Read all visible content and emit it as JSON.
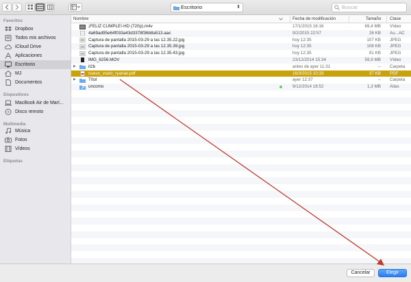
{
  "toolbar": {
    "location": "Escritorio",
    "search_placeholder": "Buscar"
  },
  "sidebar": {
    "sections": [
      {
        "title": "Favoritos",
        "items": [
          {
            "label": "Dropbox",
            "icon": "dropbox-icon"
          },
          {
            "label": "Todos mis archivos",
            "icon": "all-files-icon"
          },
          {
            "label": "iCloud Drive",
            "icon": "cloud-icon"
          },
          {
            "label": "Aplicaciones",
            "icon": "applications-icon"
          },
          {
            "label": "Escritorio",
            "icon": "desktop-icon",
            "selected": true
          },
          {
            "label": "MJ",
            "icon": "home-icon"
          },
          {
            "label": "Documentos",
            "icon": "documents-icon"
          }
        ]
      },
      {
        "title": "Dispositivos",
        "items": [
          {
            "label": "MacBook Air de Marí...",
            "icon": "laptop-icon"
          },
          {
            "label": "Disco remoto",
            "icon": "disc-icon"
          }
        ]
      },
      {
        "title": "Multimedia",
        "items": [
          {
            "label": "Música",
            "icon": "music-icon"
          },
          {
            "label": "Fotos",
            "icon": "camera-icon"
          },
          {
            "label": "Vídeos",
            "icon": "film-icon"
          }
        ]
      },
      {
        "title": "Etiquetas",
        "items": []
      }
    ]
  },
  "columns": {
    "name": "Nombre",
    "date": "Fecha de modificación",
    "size": "Tamaño",
    "kind": "Clase"
  },
  "files": [
    {
      "name": "¡FELIZ CUMPLE!-HD (720p).m4v",
      "date": "17/1/2015 16:16",
      "size": "69,4 MB",
      "kind": "Vídeo",
      "icon": "video-file-icon"
    },
    {
      "name": "4a69ad95e64f033a43d3378f36b8a513.aac",
      "date": "9/2/2015 22:57",
      "size": "26 KB",
      "kind": "Au...AC",
      "icon": "audio-file-icon"
    },
    {
      "name": "Captura de pantalla 2015-03-29 a las 12.35.22.jpg",
      "date": "hoy 12:35",
      "size": "107 KB",
      "kind": "JPEG",
      "icon": "image-file-icon"
    },
    {
      "name": "Captura de pantalla 2015-03-29 a las 12.35.39.jpg",
      "date": "hoy 12:35",
      "size": "108 KB",
      "kind": "JPEG",
      "icon": "image-file-icon"
    },
    {
      "name": "Captura de pantalla 2015-03-29 a las 12.35.43.jpg",
      "date": "hoy 12:35",
      "size": "91 KB",
      "kind": "JPEG",
      "icon": "image-file-icon"
    },
    {
      "name": "IMG_6256.MOV",
      "date": "23/12/2014 15:34",
      "size": "59,9 MB",
      "kind": "Vídeo",
      "icon": "movie-file-icon"
    },
    {
      "name": "it2b",
      "date": "antes de ayer 11:31",
      "size": "--",
      "kind": "Carpeta",
      "icon": "folder-icon",
      "folder": true
    },
    {
      "name": "nuevo_vuelo_ryanair.pdf",
      "date": "16/3/2015 10:33",
      "size": "37 KB",
      "kind": "PDF",
      "icon": "pdf-file-icon",
      "selected": true
    },
    {
      "name": "Títol",
      "date": "ayer 12:37",
      "size": "--",
      "kind": "Carpeta",
      "icon": "folder-icon",
      "folder": true
    },
    {
      "name": "uncomo",
      "date": "9/12/2014 18:52",
      "size": "1,3 MB",
      "kind": "Alias",
      "icon": "alias-icon",
      "tag": true
    }
  ],
  "colors": {
    "selection": "#c8a20d",
    "accent": "#2a7ef3",
    "annotation_arrow": "#c0392b",
    "tag_green": "#5ed35a"
  },
  "buttons": {
    "cancel": "Cancelar",
    "choose": "Elegir"
  }
}
